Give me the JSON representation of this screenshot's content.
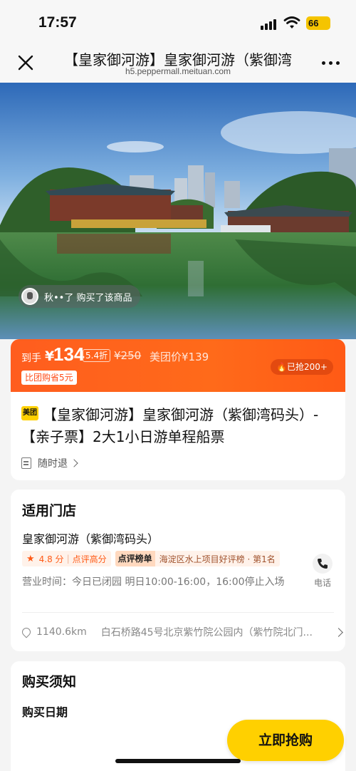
{
  "status_bar": {
    "time": "17:57",
    "battery": "66"
  },
  "browser": {
    "title": "【皇家御河游】皇家御河游（紫御湾码头）",
    "url": "h5.peppermall.meituan.com"
  },
  "hero": {
    "buyer_text": "秋••了 购买了该商品"
  },
  "price": {
    "prefix": "到手",
    "currency": "¥",
    "value": "134",
    "discount": "5.4折",
    "original": "¥250",
    "meituan_price": "美团价¥139",
    "saving": "比团购省5元",
    "sold": "已抢200+"
  },
  "product": {
    "logo": "美团",
    "title": "【皇家御河游】皇家御河游（紫御湾码头）-【亲子票】2大1小日游单程船票",
    "refund": "随时退"
  },
  "store": {
    "section_title": "适用门店",
    "name": "皇家御河游（紫御湾码头）",
    "rating": "4.8 分",
    "rating_note": "点评高分",
    "rank_label": "点评榜单",
    "rank_text": "海淀区水上项目好评榜 · 第1名",
    "phone_label": "电话",
    "hours": "营业时间：今日已闭园 明日10:00-16:00，16:00停止入场",
    "distance": "1140.6km",
    "address": "白石桥路45号北京紫竹院公园内（紫竹院北门..."
  },
  "notes": {
    "section_title": "购买须知",
    "sub_title": "购买日期"
  },
  "bottom": {
    "buy_label": "立即抢购"
  }
}
